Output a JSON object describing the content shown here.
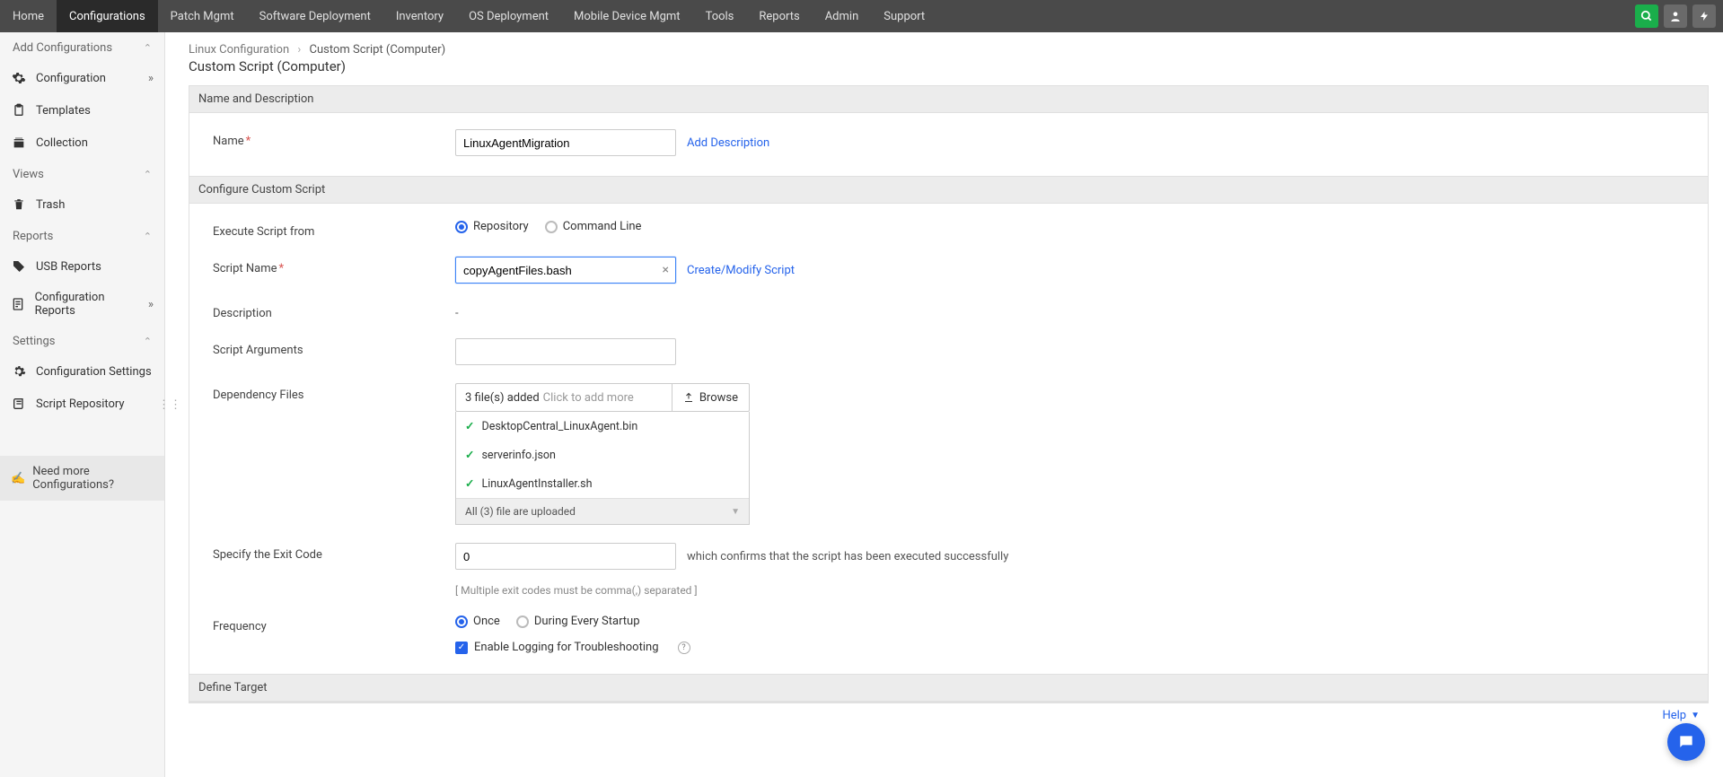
{
  "topNav": {
    "items": [
      "Home",
      "Configurations",
      "Patch Mgmt",
      "Software Deployment",
      "Inventory",
      "OS Deployment",
      "Mobile Device Mgmt",
      "Tools",
      "Reports",
      "Admin",
      "Support"
    ],
    "activeIndex": 1
  },
  "sidebar": {
    "sections": {
      "add": {
        "title": "Add Configurations",
        "items": [
          {
            "label": "Configuration",
            "icon": "gear",
            "hasArrow": true
          },
          {
            "label": "Templates",
            "icon": "clipboard"
          },
          {
            "label": "Collection",
            "icon": "collection"
          }
        ]
      },
      "views": {
        "title": "Views",
        "items": [
          {
            "label": "Trash",
            "icon": "trash"
          }
        ]
      },
      "reports": {
        "title": "Reports",
        "items": [
          {
            "label": "USB Reports",
            "icon": "tag"
          },
          {
            "label": "Configuration Reports",
            "icon": "report",
            "hasArrow": true
          }
        ]
      },
      "settings": {
        "title": "Settings",
        "items": [
          {
            "label": "Configuration Settings",
            "icon": "sliders"
          },
          {
            "label": "Script Repository",
            "icon": "script"
          }
        ]
      }
    },
    "footer": "Need more Configurations?"
  },
  "breadcrumb": {
    "parent": "Linux Configuration",
    "current": "Custom Script (Computer)"
  },
  "pageTitle": "Custom Script (Computer)",
  "sections": {
    "nameDesc": "Name and Description",
    "configure": "Configure Custom Script",
    "defineTarget": "Define Target"
  },
  "form": {
    "nameLabel": "Name",
    "nameValue": "LinuxAgentMigration",
    "addDescLink": "Add Description",
    "execLabel": "Execute Script from",
    "execOptions": {
      "repo": "Repository",
      "cmd": "Command Line"
    },
    "scriptNameLabel": "Script Name",
    "scriptNameValue": "copyAgentFiles.bash",
    "createModifyLink": "Create/Modify Script",
    "descriptionLabel": "Description",
    "descriptionValue": "-",
    "argsLabel": "Script Arguments",
    "depLabel": "Dependency Files",
    "depAdded": "3 file(s) added",
    "depHint": "Click to add more",
    "browseLabel": "Browse",
    "depFiles": [
      "DesktopCentral_LinuxAgent.bin",
      "serverinfo.json",
      "LinuxAgentInstaller.sh"
    ],
    "depStatus": "All (3) file are uploaded",
    "exitLabel": "Specify the Exit Code",
    "exitValue": "0",
    "exitHelp": "which confirms that the script has been executed successfully",
    "exitHint": "[ Multiple exit codes must be comma(,) separated ]",
    "freqLabel": "Frequency",
    "freqOptions": {
      "once": "Once",
      "startup": "During Every Startup"
    },
    "loggingLabel": "Enable Logging for Troubleshooting"
  },
  "helpLink": "Help"
}
